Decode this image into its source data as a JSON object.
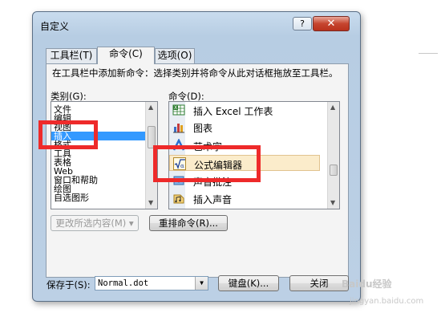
{
  "window": {
    "title": "自定义",
    "help_label": "?",
    "close_label": "✕"
  },
  "tabs": [
    {
      "label": "工具栏(T)"
    },
    {
      "label": "命令(C)"
    },
    {
      "label": "选项(O)"
    }
  ],
  "description": "在工具栏中添加新命令：选择类别并将命令从此对话框拖放至工具栏。",
  "categories": {
    "label": "类别(G):",
    "items": [
      "文件",
      "编辑",
      "视图",
      "插入",
      "格式",
      "工具",
      "表格",
      "Web",
      "窗口和帮助",
      "绘图",
      "自选图形"
    ],
    "selected": "插入"
  },
  "commands": {
    "label": "命令(D):",
    "items": [
      {
        "label": "插入 Excel 工作表",
        "icon": "excel-worksheet-icon"
      },
      {
        "label": "图表",
        "icon": "chart-icon"
      },
      {
        "label": "艺术字",
        "icon": "wordart-icon"
      },
      {
        "label": "公式编辑器",
        "icon": "equation-editor-icon"
      },
      {
        "label": "声音批注",
        "icon": "voice-comment-icon"
      },
      {
        "label": "插入声音",
        "icon": "insert-sound-icon"
      }
    ],
    "selected": "公式编辑器"
  },
  "buttons": {
    "modify_selection": "更改所选内容(M) ▾",
    "rearrange": "重排命令(R)...",
    "keyboard": "键盘(K)...",
    "close": "关闭"
  },
  "save_in": {
    "label": "保存于(S):",
    "value": "Normal.dot"
  },
  "watermark": {
    "text1": "Baidu经验",
    "text2": "jingyan.baidu.com"
  },
  "colors": {
    "highlight": "#ee2a2a",
    "selection": "#3399ff"
  }
}
